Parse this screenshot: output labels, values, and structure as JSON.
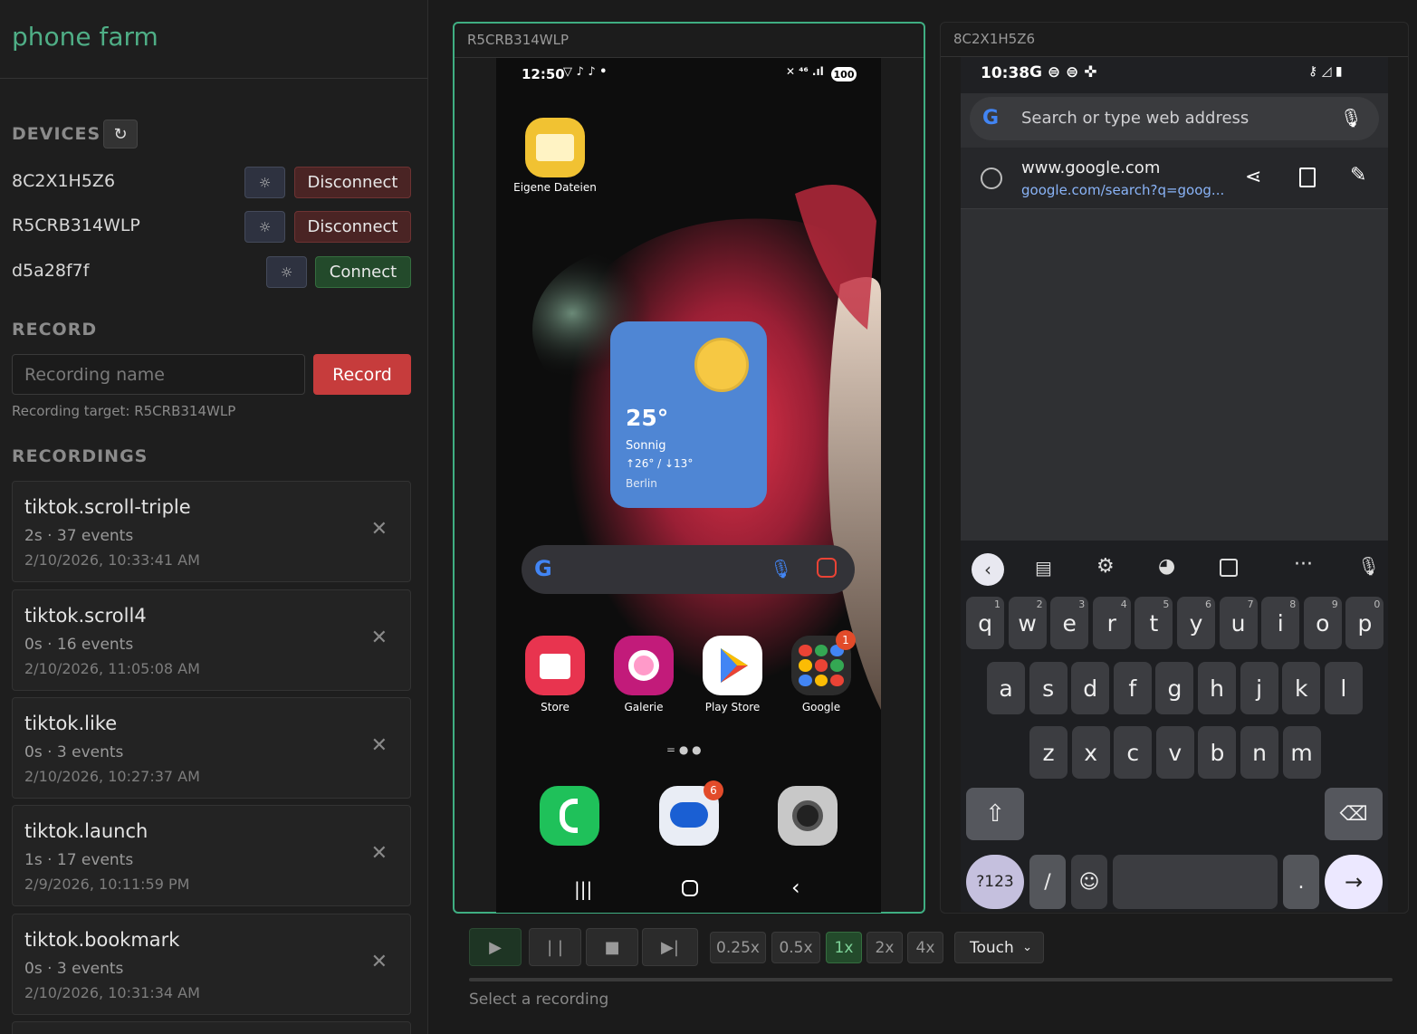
{
  "app": {
    "title": "phone farm"
  },
  "sidebar": {
    "devices_heading": "DEVICES",
    "refresh_icon": "↻",
    "devices": [
      {
        "id": "8C2X1H5Z6",
        "action": "Disconnect"
      },
      {
        "id": "R5CRB314WLP",
        "action": "Disconnect"
      },
      {
        "id": "d5a28f7f",
        "action": "Connect"
      }
    ],
    "gear_icon": "☼",
    "record_heading": "RECORD",
    "record_placeholder": "Recording name",
    "record_button": "Record",
    "record_target": "Recording target: R5CRB314WLP",
    "recordings_heading": "RECORDINGS",
    "recordings": [
      {
        "name": "tiktok.scroll-triple",
        "meta": "2s · 37 events",
        "date": "2/10/2026, 10:33:41 AM"
      },
      {
        "name": "tiktok.scroll4",
        "meta": "0s · 16 events",
        "date": "2/10/2026, 11:05:08 AM"
      },
      {
        "name": "tiktok.like",
        "meta": "0s · 3 events",
        "date": "2/10/2026, 10:27:37 AM"
      },
      {
        "name": "tiktok.launch",
        "meta": "1s · 17 events",
        "date": "2/9/2026, 10:11:59 PM"
      },
      {
        "name": "tiktok.bookmark",
        "meta": "0s · 3 events",
        "date": "2/10/2026, 10:31:34 AM"
      }
    ],
    "delete_icon": "✕"
  },
  "device_a": {
    "label": "R5CRB314WLP",
    "time": "12:50",
    "battery": "100",
    "folder_label": "Eigene Dateien",
    "weather": {
      "temp": "25°",
      "cond": "Sonnig",
      "range": "↑26° / ↓13°",
      "city": "Berlin"
    },
    "apps": [
      {
        "label": "Store"
      },
      {
        "label": "Galerie"
      },
      {
        "label": "Play Store"
      },
      {
        "label": "Google",
        "badge": "1"
      }
    ],
    "messages_badge": "6"
  },
  "device_b": {
    "label": "8C2X1H5Z6",
    "time": "10:38",
    "omnibox_placeholder": "Search or type web address",
    "suggestion_title": "www.google.com",
    "suggestion_url": "google.com/search?q=goog...",
    "keyboard": {
      "row1": [
        [
          "q",
          "1"
        ],
        [
          "w",
          "2"
        ],
        [
          "e",
          "3"
        ],
        [
          "r",
          "4"
        ],
        [
          "t",
          "5"
        ],
        [
          "y",
          "6"
        ],
        [
          "u",
          "7"
        ],
        [
          "i",
          "8"
        ],
        [
          "o",
          "9"
        ],
        [
          "p",
          "0"
        ]
      ],
      "row2": [
        "a",
        "s",
        "d",
        "f",
        "g",
        "h",
        "j",
        "k",
        "l"
      ],
      "row3": [
        "z",
        "x",
        "c",
        "v",
        "b",
        "n",
        "m"
      ],
      "sym_key": "?123",
      "slash_key": "/",
      "period_key": "."
    }
  },
  "player": {
    "speeds": [
      "0.25x",
      "0.5x",
      "1x",
      "2x",
      "4x"
    ],
    "active_speed": "1x",
    "mode": "Touch",
    "status": "Select a recording"
  },
  "colors": {
    "accent": "#3fae82",
    "record": "#c63c3c",
    "disconnect": "#4a2424",
    "connect": "#234a2b"
  }
}
